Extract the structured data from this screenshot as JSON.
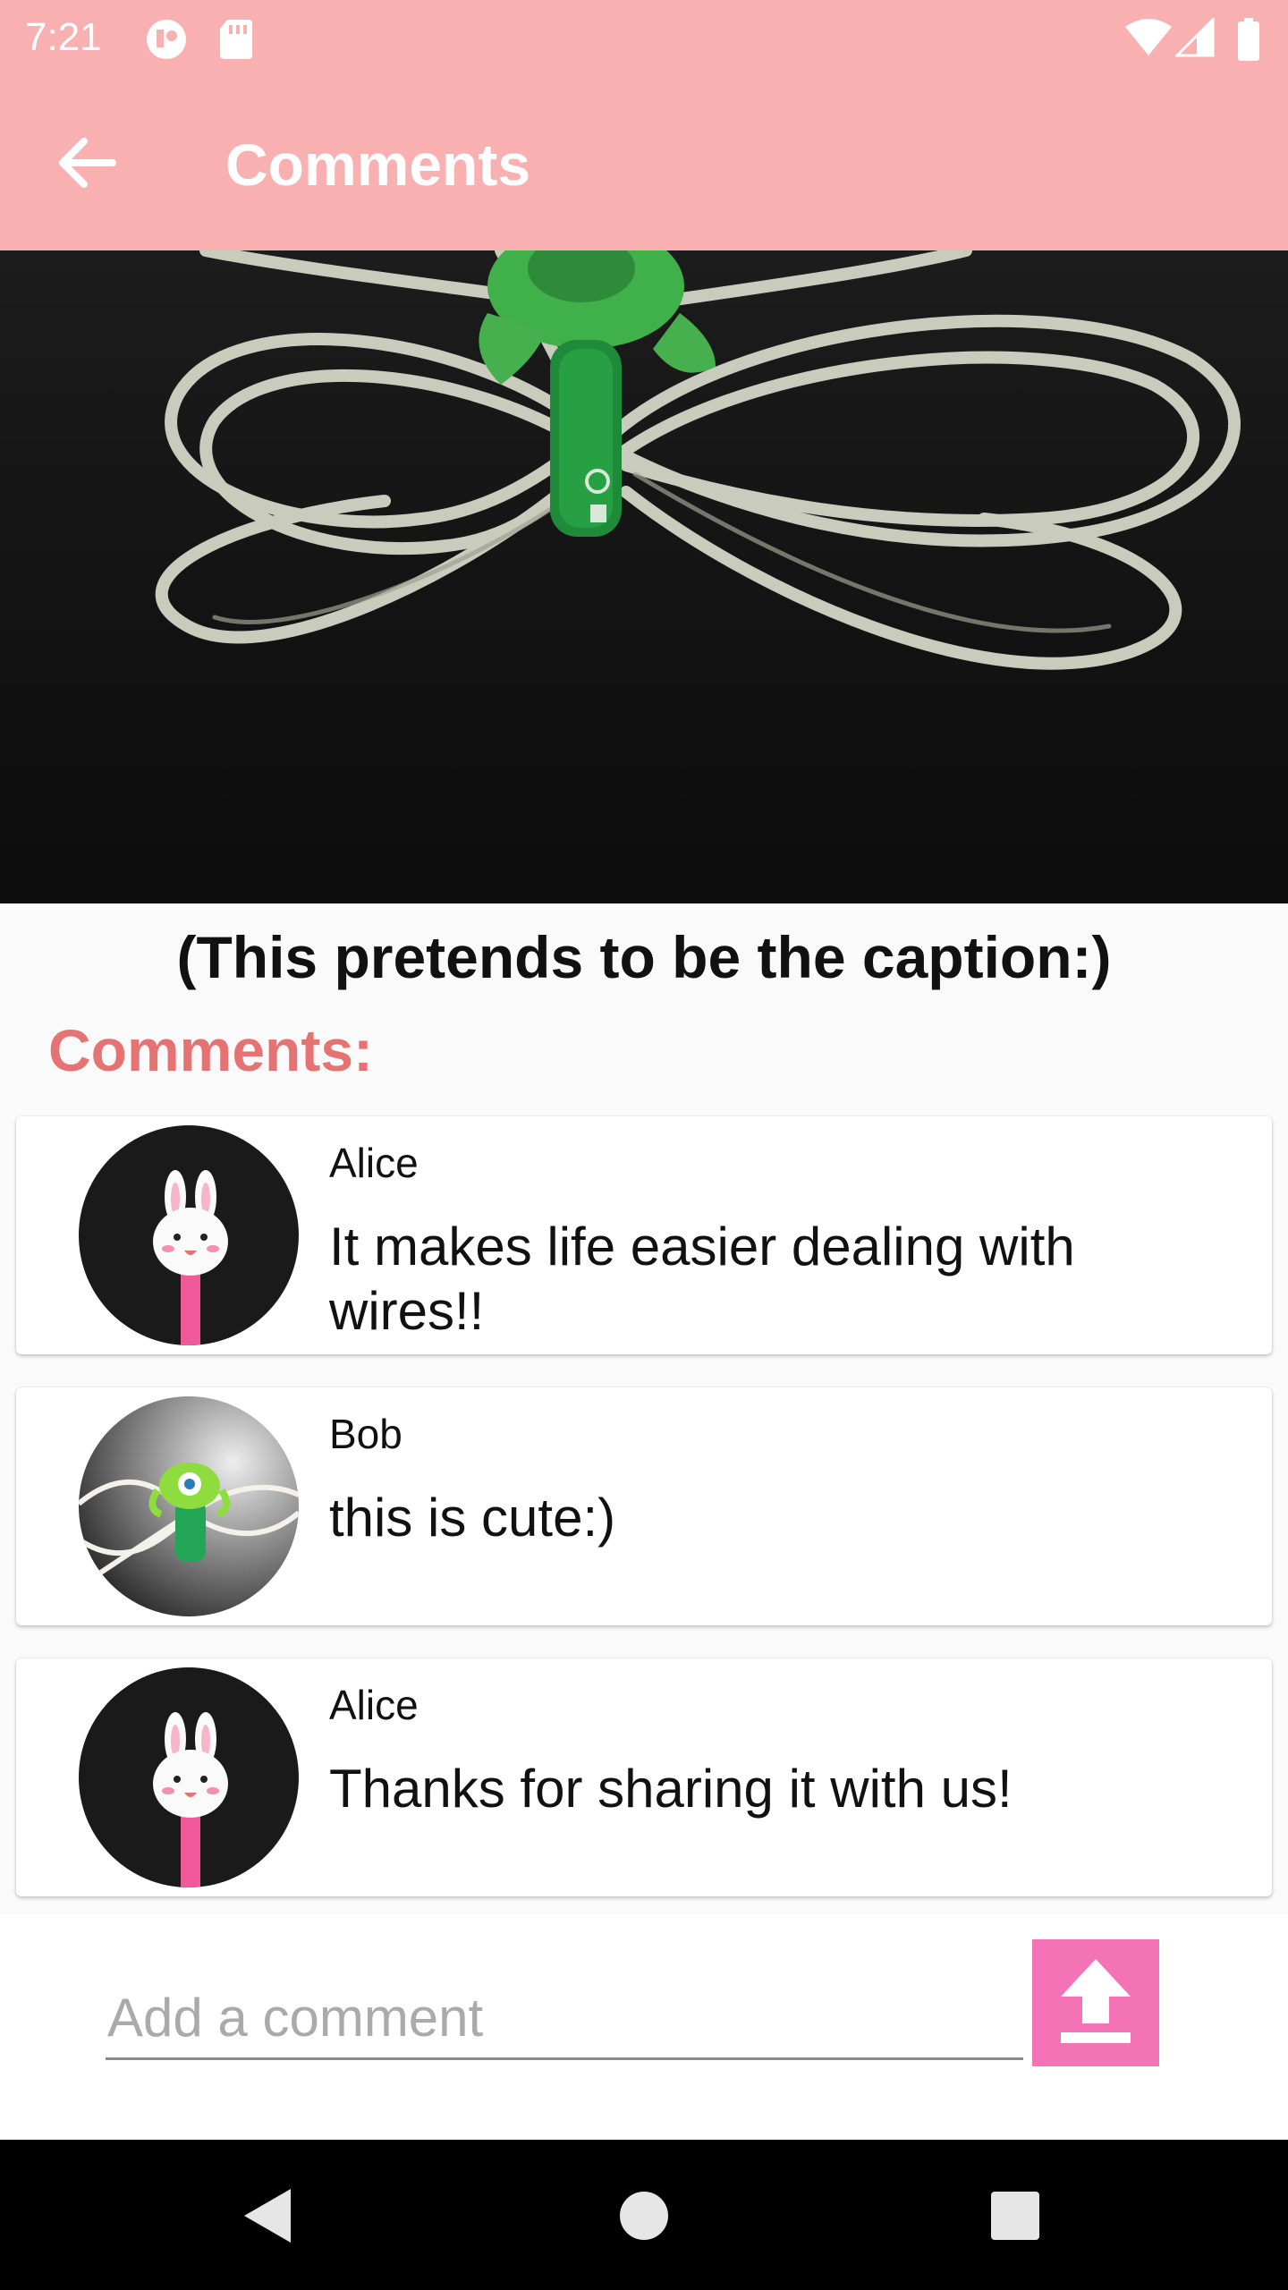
{
  "status_bar": {
    "time": "7:21",
    "icons": [
      "shield-icon",
      "sd-card-icon",
      "wifi-icon",
      "signal-icon",
      "battery-icon"
    ]
  },
  "app_bar": {
    "title": "Comments",
    "back_icon": "arrow-back-icon"
  },
  "post": {
    "caption": "(This pretends to be the caption:)"
  },
  "comments_heading": "Comments:",
  "comments": [
    {
      "author": "Alice",
      "text": "It makes life easier dealing with wires!!",
      "avatar": "bunny-clip"
    },
    {
      "author": "Bob",
      "text": "this is cute:)",
      "avatar": "monster-clip"
    },
    {
      "author": "Alice",
      "text": "Thanks for sharing it with us!",
      "avatar": "bunny-clip"
    }
  ],
  "composer": {
    "placeholder": "Add a comment",
    "send_icon": "upload-icon"
  },
  "nav_bar": {
    "icons": [
      "back-triangle-icon",
      "home-circle-icon",
      "recents-square-icon"
    ]
  },
  "colors": {
    "app_bar": "#f8b0b0",
    "heading": "#e57373",
    "send_button": "#f472b6"
  }
}
